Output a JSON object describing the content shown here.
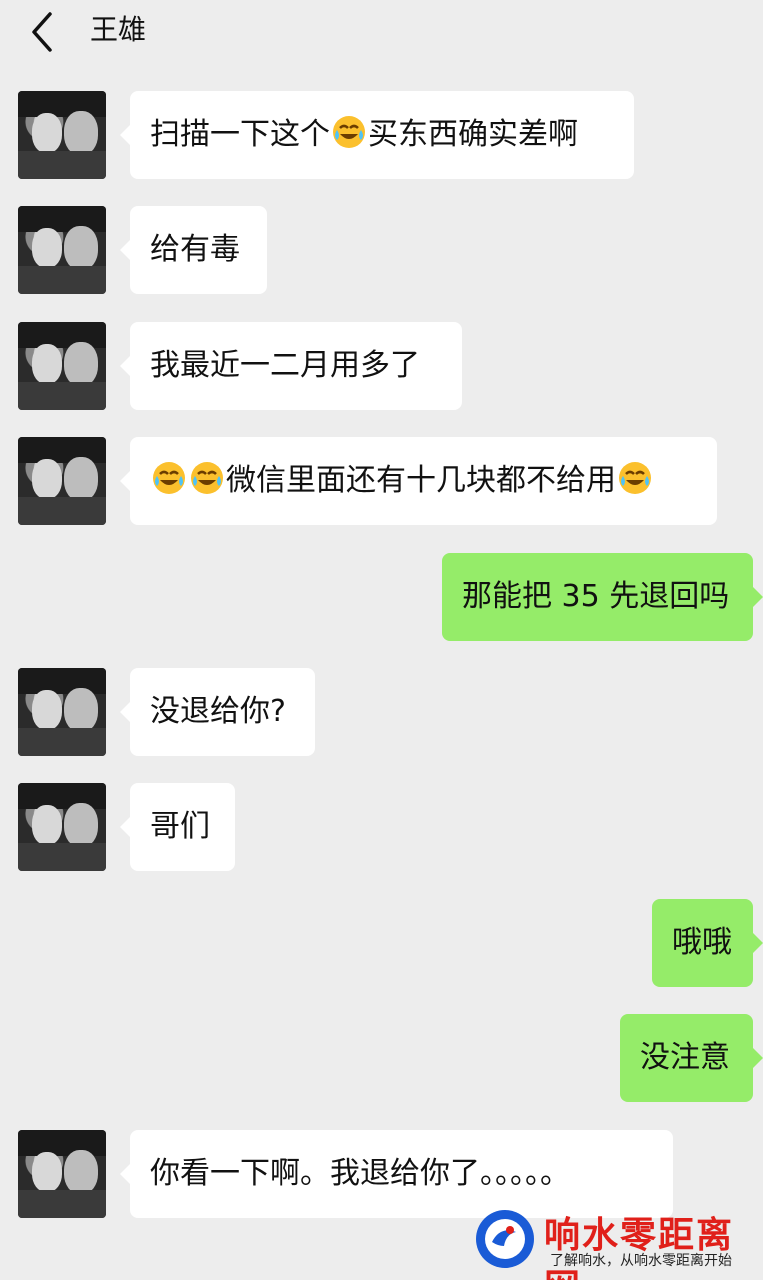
{
  "header": {
    "title": "王雄",
    "back_icon": "chevron-left-icon"
  },
  "colors": {
    "background": "#ededed",
    "incoming_bubble": "#ffffff",
    "outgoing_bubble": "#95ec69",
    "watermark_red": "#e0201a",
    "watermark_blue": "#1a5bd6"
  },
  "messages": [
    {
      "side": "in",
      "parts": [
        {
          "t": "扫描一下这个"
        },
        {
          "e": "crying-laughing-emoji"
        },
        {
          "t": "买东西确实差啊"
        }
      ]
    },
    {
      "side": "in",
      "text": "给有毒"
    },
    {
      "side": "in",
      "text": "我最近一二月用多了"
    },
    {
      "side": "in",
      "parts": [
        {
          "e": "crying-laughing-emoji"
        },
        {
          "e": "crying-laughing-emoji"
        },
        {
          "t": "微信里面还有十几块都不给用"
        },
        {
          "e": "crying-laughing-emoji"
        }
      ]
    },
    {
      "side": "out",
      "text": "那能把 35 先退回吗"
    },
    {
      "side": "in",
      "text": "没退给你?"
    },
    {
      "side": "in",
      "text": "哥们"
    },
    {
      "side": "out",
      "text": "哦哦"
    },
    {
      "side": "out",
      "text": "没注意"
    },
    {
      "side": "in",
      "text": "你看一下啊。我退给你了。。。。。"
    }
  ],
  "watermark": {
    "title": "响水零距离网",
    "subtitle": "了解响水，从响水零距离开始"
  }
}
